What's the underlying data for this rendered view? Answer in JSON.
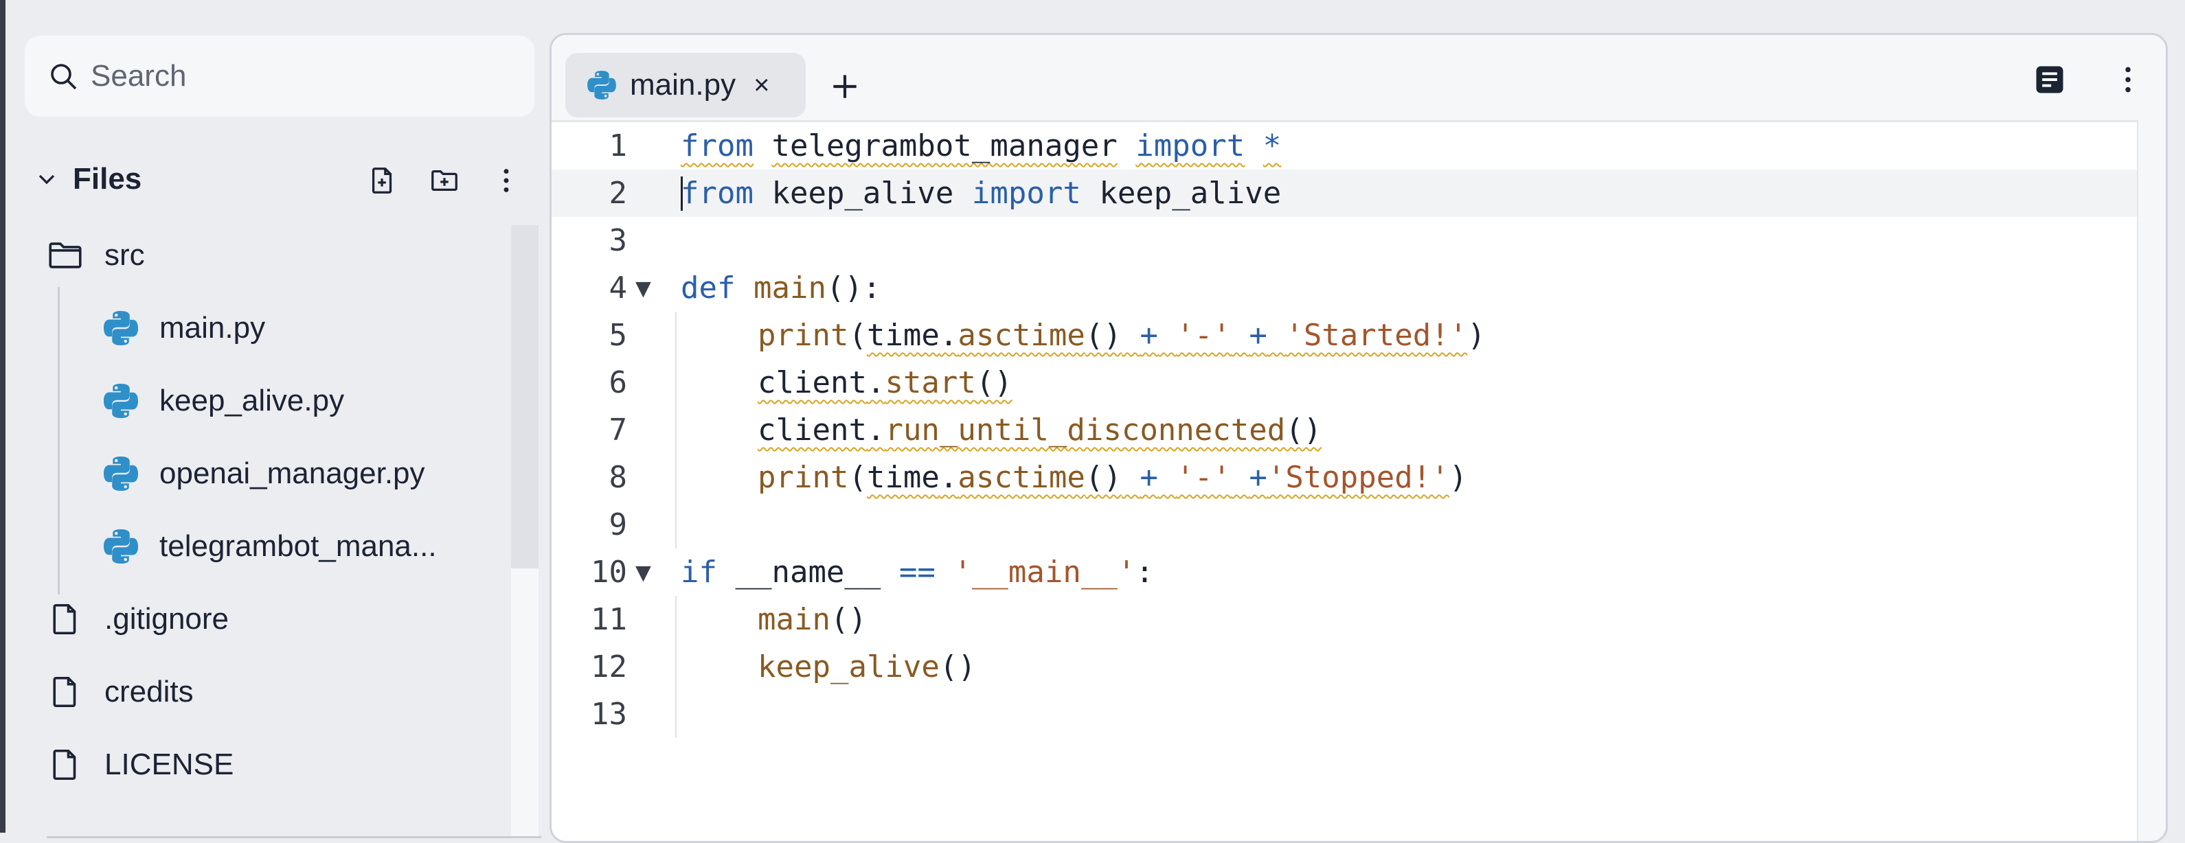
{
  "sidebar": {
    "search_placeholder": "Search",
    "files_title": "Files",
    "tree": [
      {
        "label": "src",
        "icon": "folder-icon",
        "depth": 0
      },
      {
        "label": "main.py",
        "icon": "python-icon",
        "depth": 1
      },
      {
        "label": "keep_alive.py",
        "icon": "python-icon",
        "depth": 1
      },
      {
        "label": "openai_manager.py",
        "icon": "python-icon",
        "depth": 1
      },
      {
        "label": "telegrambot_mana...",
        "icon": "python-icon",
        "depth": 1
      },
      {
        "label": ".gitignore",
        "icon": "file-icon",
        "depth": 0
      },
      {
        "label": "credits",
        "icon": "file-icon",
        "depth": 0
      },
      {
        "label": "LICENSE",
        "icon": "file-icon",
        "depth": 0
      }
    ]
  },
  "editor": {
    "tab_label": "main.py",
    "tab_close": "×",
    "code_lines": [
      {
        "n": "1",
        "fold": "",
        "indent": false
      },
      {
        "n": "2",
        "fold": "",
        "indent": false
      },
      {
        "n": "3",
        "fold": "",
        "indent": false
      },
      {
        "n": "4",
        "fold": "▼",
        "indent": false
      },
      {
        "n": "5",
        "fold": "",
        "indent": true
      },
      {
        "n": "6",
        "fold": "",
        "indent": true
      },
      {
        "n": "7",
        "fold": "",
        "indent": true
      },
      {
        "n": "8",
        "fold": "",
        "indent": true
      },
      {
        "n": "9",
        "fold": "",
        "indent": true
      },
      {
        "n": "10",
        "fold": "▼",
        "indent": false
      },
      {
        "n": "11",
        "fold": "",
        "indent": true
      },
      {
        "n": "12",
        "fold": "",
        "indent": true
      },
      {
        "n": "13",
        "fold": "",
        "indent": true
      }
    ],
    "tokens": {
      "l1": [
        "from",
        "telegrambot_manager",
        "import",
        "*"
      ],
      "l2": [
        "from",
        "keep_alive",
        "import",
        "keep_alive"
      ],
      "l4": [
        "def",
        "main",
        "():"
      ],
      "l5": [
        "print",
        "(",
        "time",
        ".",
        "asctime",
        "()",
        "+",
        "'-'",
        "+",
        "'Started!'",
        ")"
      ],
      "l6": [
        "client",
        ".",
        "start",
        "()"
      ],
      "l7": [
        "client",
        ".",
        "run_until_disconnected",
        "()"
      ],
      "l8": [
        "print",
        "(",
        "time",
        ".",
        "asctime",
        "()",
        "+",
        "'-'",
        "+",
        "'Stopped!'",
        ")"
      ],
      "l10": [
        "if",
        "__name__",
        "==",
        "'__main__'",
        ":"
      ],
      "l11": [
        "main",
        "()"
      ],
      "l12": [
        "keep_alive",
        "()"
      ]
    }
  },
  "colors": {
    "keyword": "#2a5fa8",
    "function": "#8a5a22",
    "string": "#a5552b",
    "python_icon": "#2f8fc8"
  }
}
